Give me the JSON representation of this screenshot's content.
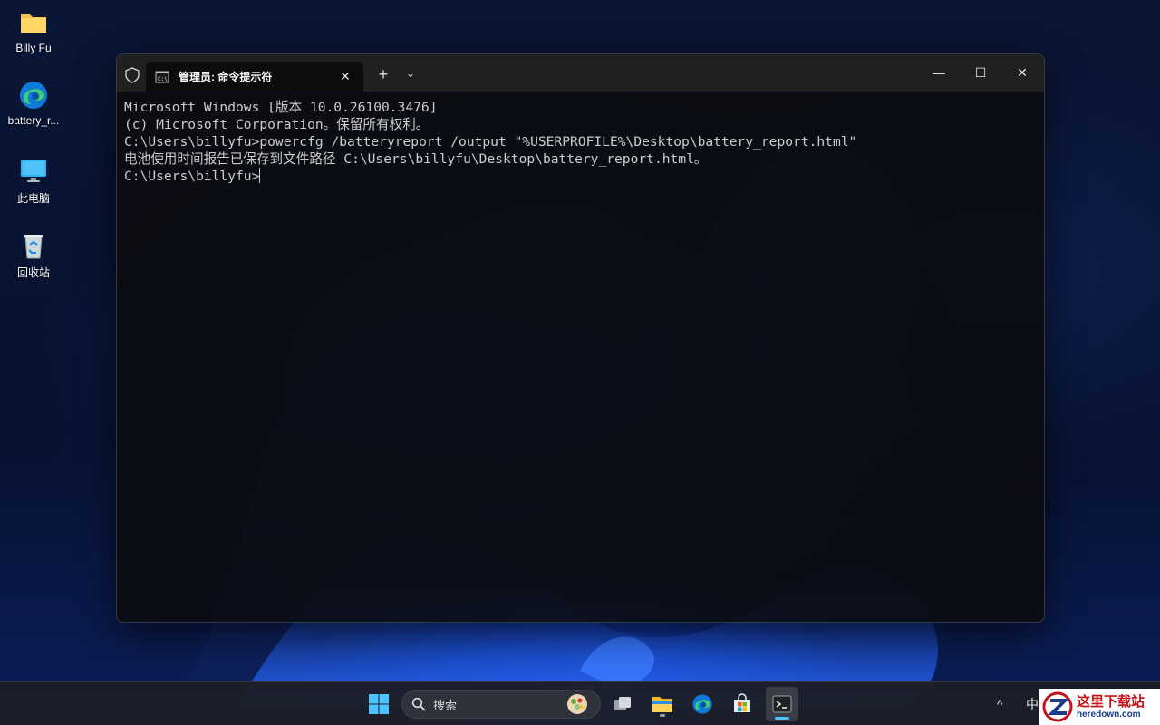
{
  "desktop": {
    "icons": [
      {
        "label": "Billy Fu",
        "icon": "folder-icon"
      },
      {
        "label": "battery_r...",
        "icon": "edge-icon"
      },
      {
        "label": "此电脑",
        "icon": "monitor-icon"
      },
      {
        "label": "回收站",
        "icon": "recycle-bin-icon"
      }
    ]
  },
  "terminal": {
    "tab_title": "管理员: 命令提示符",
    "tab_close": "✕",
    "new_tab": "+",
    "dropdown": "⌄",
    "controls": {
      "minimize": "—",
      "maximize": "☐",
      "close": "✕"
    },
    "lines": [
      "Microsoft Windows [版本 10.0.26100.3476]",
      "(c) Microsoft Corporation。保留所有权利。",
      "",
      "C:\\Users\\billyfu>powercfg /batteryreport /output \"%USERPROFILE%\\Desktop\\battery_report.html\"",
      "电池使用时间报告已保存到文件路径 C:\\Users\\billyfu\\Desktop\\battery_report.html。",
      "",
      "C:\\Users\\billyfu>"
    ]
  },
  "taskbar": {
    "search_placeholder": "搜索",
    "tray": {
      "chevron": "^",
      "ime": "中"
    }
  },
  "watermark": {
    "cn": "这里下载站",
    "en": "heredown.com"
  },
  "colors": {
    "accent": "#4cc2ff",
    "terminal_text": "#cccccc",
    "titlebar": "#202020"
  }
}
